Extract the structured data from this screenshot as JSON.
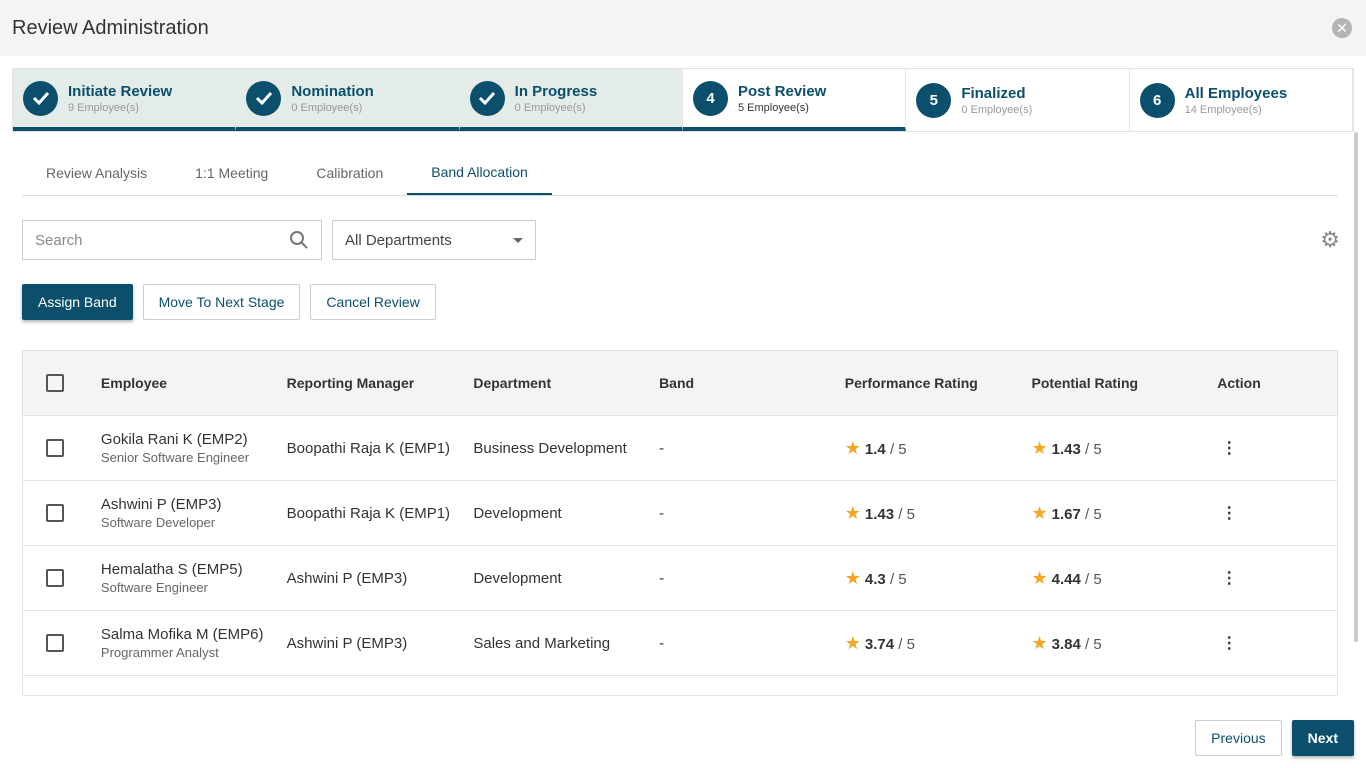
{
  "title": "Review Administration",
  "steps": [
    {
      "num": "",
      "label": "Initiate Review",
      "sub": "9 Employee(s)",
      "state": "done"
    },
    {
      "num": "",
      "label": "Nomination",
      "sub": "0 Employee(s)",
      "state": "done"
    },
    {
      "num": "",
      "label": "In Progress",
      "sub": "0 Employee(s)",
      "state": "done"
    },
    {
      "num": "4",
      "label": "Post Review",
      "sub": "5 Employee(s)",
      "state": "active"
    },
    {
      "num": "5",
      "label": "Finalized",
      "sub": "0 Employee(s)",
      "state": "todo"
    },
    {
      "num": "6",
      "label": "All Employees",
      "sub": "14 Employee(s)",
      "state": "todo"
    }
  ],
  "tabs": [
    "Review Analysis",
    "1:1 Meeting",
    "Calibration",
    "Band Allocation"
  ],
  "active_tab": "Band Allocation",
  "search": {
    "placeholder": "Search",
    "value": ""
  },
  "department": "All Departments",
  "buttons": {
    "assign": "Assign Band",
    "move": "Move To Next Stage",
    "cancel": "Cancel Review",
    "previous": "Previous",
    "next": "Next"
  },
  "columns": [
    "Employee",
    "Reporting Manager",
    "Department",
    "Band",
    "Performance Rating",
    "Potential Rating",
    "Action"
  ],
  "rows": [
    {
      "name": "Gokila Rani K (EMP2)",
      "title": "Senior Software Engineer",
      "manager": "Boopathi Raja K (EMP1)",
      "dept": "Business Development",
      "band": "-",
      "perf": "1.4",
      "pot": "1.43"
    },
    {
      "name": "Ashwini P (EMP3)",
      "title": "Software Developer",
      "manager": "Boopathi Raja K (EMP1)",
      "dept": "Development",
      "band": "-",
      "perf": "1.43",
      "pot": "1.67"
    },
    {
      "name": "Hemalatha S (EMP5)",
      "title": "Software Engineer",
      "manager": "Ashwini P (EMP3)",
      "dept": "Development",
      "band": "-",
      "perf": "4.3",
      "pot": "4.44"
    },
    {
      "name": "Salma Mofika M (EMP6)",
      "title": "Programmer Analyst",
      "manager": "Ashwini P (EMP3)",
      "dept": "Sales and Marketing",
      "band": "-",
      "perf": "3.74",
      "pot": "3.84"
    }
  ],
  "rating_max": "/ 5",
  "colors": {
    "primary": "#0b4f6c",
    "completed_bg": "#e3ece9",
    "star": "#f5a623"
  }
}
